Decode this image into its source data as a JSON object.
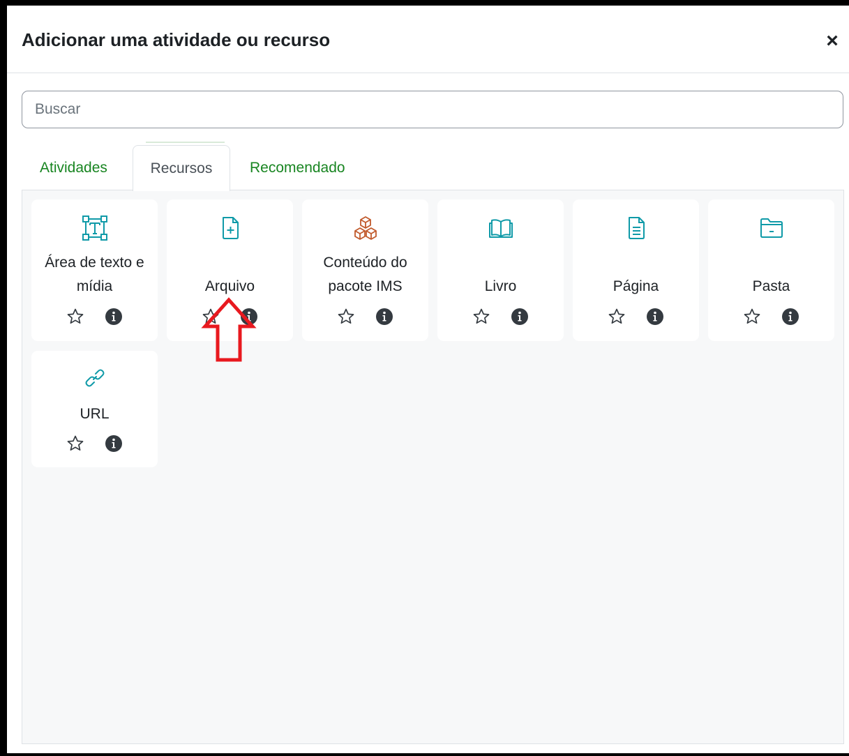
{
  "dialog": {
    "title": "Adicionar uma atividade ou recurso",
    "close_label": "×"
  },
  "search": {
    "placeholder": "Buscar",
    "value": ""
  },
  "tabs": [
    {
      "label": "Atividades",
      "active": false
    },
    {
      "label": "Recursos",
      "active": true
    },
    {
      "label": "Recomendado",
      "active": false
    }
  ],
  "colors": {
    "tab_link": "#188521",
    "icon_teal": "#0f9aa8",
    "icon_orange": "#c15a2c",
    "annotation_arrow": "#e8191f"
  },
  "resources": [
    {
      "label": "Área de texto e mídia",
      "icon": "text-frame-icon"
    },
    {
      "label": "Arquivo",
      "icon": "file-plus-icon"
    },
    {
      "label": "Conteúdo do pacote IMS",
      "icon": "cubes-icon"
    },
    {
      "label": "Livro",
      "icon": "book-icon"
    },
    {
      "label": "Página",
      "icon": "page-document-icon"
    },
    {
      "label": "Pasta",
      "icon": "folder-icon"
    },
    {
      "label": "URL",
      "icon": "link-icon"
    }
  ]
}
